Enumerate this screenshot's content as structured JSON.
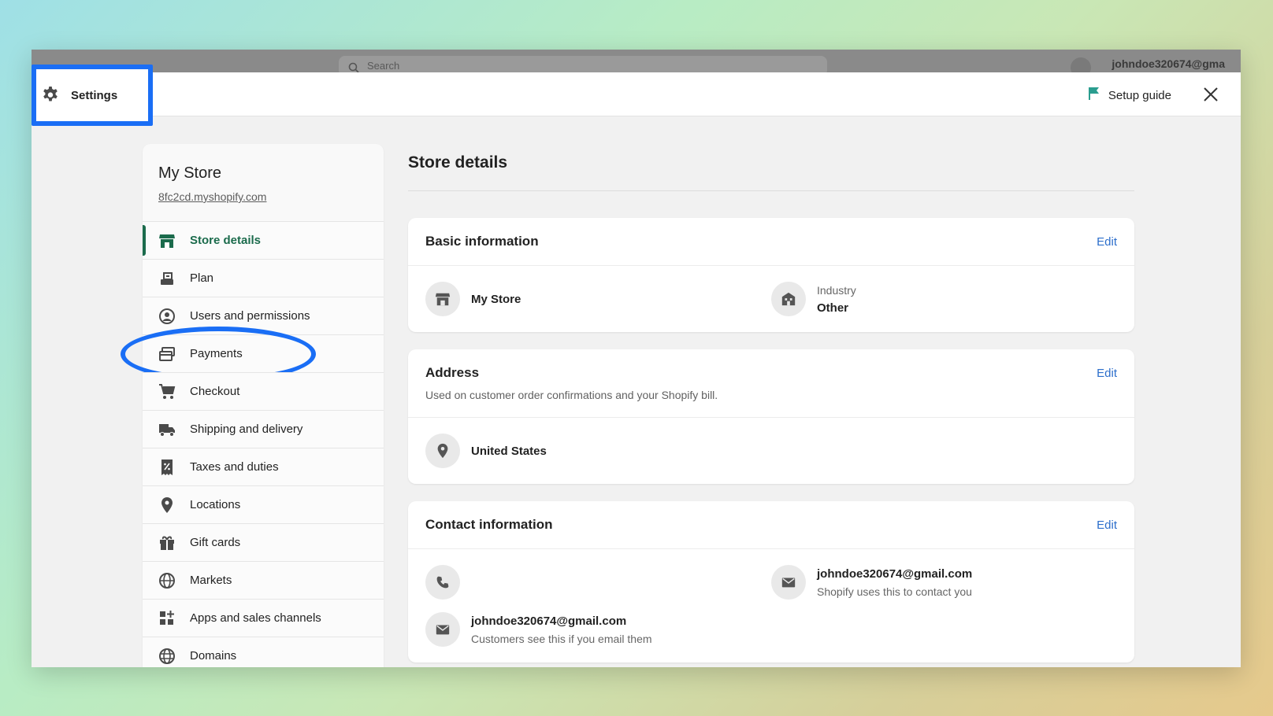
{
  "background_app": {
    "search_placeholder": "Search",
    "user_label": "johndoe320674@gma"
  },
  "header": {
    "settings_label": "Settings",
    "setup_guide_label": "Setup guide"
  },
  "sidebar": {
    "store_name": "My Store",
    "store_url": "8fc2cd.myshopify.com",
    "items": [
      {
        "label": "Store details",
        "icon": "store-icon",
        "active": true
      },
      {
        "label": "Plan",
        "icon": "plan-icon"
      },
      {
        "label": "Users and permissions",
        "icon": "user-icon"
      },
      {
        "label": "Payments",
        "icon": "payments-icon"
      },
      {
        "label": "Checkout",
        "icon": "cart-icon"
      },
      {
        "label": "Shipping and delivery",
        "icon": "truck-icon"
      },
      {
        "label": "Taxes and duties",
        "icon": "receipt-icon"
      },
      {
        "label": "Locations",
        "icon": "location-pin-icon"
      },
      {
        "label": "Gift cards",
        "icon": "gift-icon"
      },
      {
        "label": "Markets",
        "icon": "globe-icon"
      },
      {
        "label": "Apps and sales channels",
        "icon": "apps-icon"
      },
      {
        "label": "Domains",
        "icon": "domain-globe-icon"
      }
    ]
  },
  "main": {
    "title": "Store details",
    "basic": {
      "title": "Basic information",
      "edit": "Edit",
      "store_name": "My Store",
      "industry_label": "Industry",
      "industry_value": "Other"
    },
    "address": {
      "title": "Address",
      "edit": "Edit",
      "subtitle": "Used on customer order confirmations and your Shopify bill.",
      "country": "United States"
    },
    "contact": {
      "title": "Contact information",
      "edit": "Edit",
      "store_email": "johndoe320674@gmail.com",
      "store_email_note": "Shopify uses this to contact you",
      "sender_email": "johndoe320674@gmail.com",
      "sender_email_note": "Customers see this if you email them"
    }
  },
  "colors": {
    "highlight": "#1a6ef5",
    "active_nav": "#1b6b4c",
    "link": "#2c6ecb",
    "setup_flag": "#2a9d8f"
  }
}
